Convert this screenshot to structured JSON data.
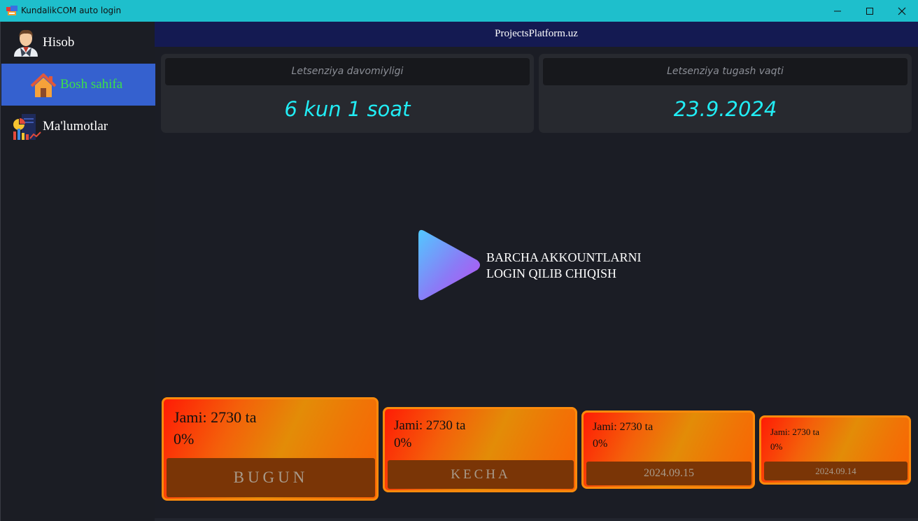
{
  "window": {
    "title": "KundalikCOM auto login",
    "titlebar_color": "#1ebfcc"
  },
  "sidebar": {
    "items": [
      {
        "label": "Hisob",
        "icon": "user-avatar-icon"
      },
      {
        "label": "Bosh sahifa",
        "icon": "home-icon",
        "active": true
      },
      {
        "label": "Ma'lumotlar",
        "icon": "stats-icon"
      }
    ],
    "active_color": "#3561cf",
    "active_text_color": "#3ce14a"
  },
  "header": {
    "title": "ProjectsPlatform.uz"
  },
  "license": {
    "duration_label": "Letsenziya davomiyligi",
    "duration_value": "6 kun 1 soat",
    "expiry_label": "Letsenziya tugash vaqti",
    "expiry_value": "23.9.2024",
    "value_color": "#21ecf4"
  },
  "action": {
    "line1": "BARCHA AKKOUNTLARNI",
    "line2": "LOGIN QILIB CHIQISH",
    "icon": "play-icon"
  },
  "stats": [
    {
      "total": "Jami: 2730 ta",
      "percent": "0%",
      "label": "BUGUN"
    },
    {
      "total": "Jami: 2730 ta",
      "percent": "0%",
      "label": "KECHA"
    },
    {
      "total": "Jami: 2730 ta",
      "percent": "0%",
      "label": "2024.09.15"
    },
    {
      "total": "Jami: 2730 ta",
      "percent": "0%",
      "label": "2024.09.14"
    }
  ]
}
